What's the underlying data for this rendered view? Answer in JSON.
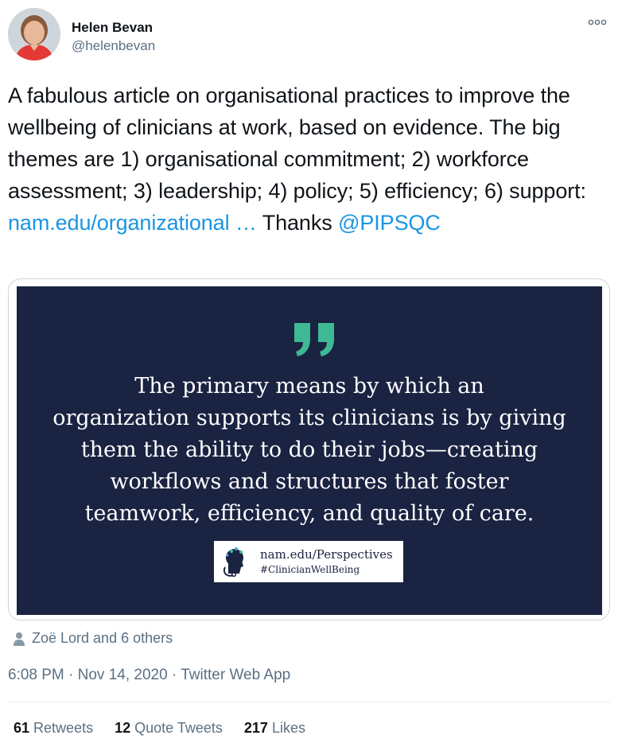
{
  "author": {
    "name": "Helen Bevan",
    "handle": "@helenbevan"
  },
  "more_icon": "more-horizontal-icon",
  "tweet": {
    "text_before": "A fabulous article on organisational practices to improve the wellbeing of clinicians at work, based on evidence. The big themes are 1) organisational commitment; 2) workforce assessment; 3) leadership; 4) policy; 5) efficiency; 6) support: ",
    "link": "nam.edu/organizational …",
    "text_middle": " Thanks ",
    "mention": "@PIPSQC"
  },
  "media": {
    "quote_lines": [
      "The primary means by which an",
      "organization supports its clinicians is by giving",
      "them the ability to do their jobs—creating",
      "workflows and structures that foster",
      "teamwork, efficiency, and quality of care."
    ],
    "logo_url": "nam.edu/Perspectives",
    "logo_tag": "#ClinicianWellBeing",
    "colors": {
      "background": "#1a2341",
      "quote_mark": "#3fb894"
    }
  },
  "likers": "Zoë Lord and 6 others",
  "timestamp": "6:08 PM · Nov 14, 2020 · Twitter Web App",
  "stats": {
    "retweets_count": "61",
    "retweets_label": "Retweets",
    "quotes_count": "12",
    "quotes_label": "Quote Tweets",
    "likes_count": "217",
    "likes_label": "Likes"
  },
  "colors": {
    "link": "#1b95e0",
    "secondary_text": "#5b7083"
  }
}
